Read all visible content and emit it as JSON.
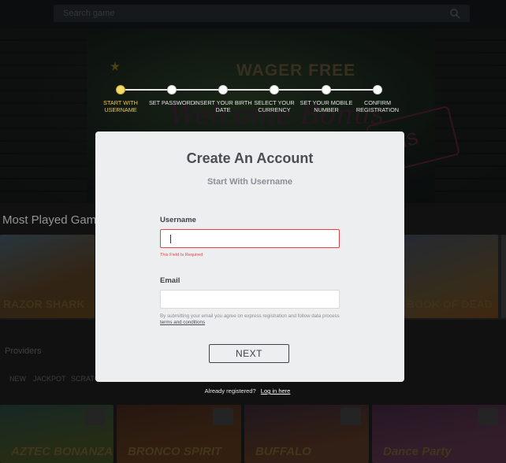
{
  "header": {
    "search_placeholder": "Search game"
  },
  "hero": {
    "neon_title": "WAGER FREE",
    "neon_script": "Welcome Bonus",
    "neon_sign": "NS"
  },
  "background": {
    "section_title": "Most Played Games",
    "tile_labels": [
      "RAZOR SHARK",
      "BOOK OF DEAD"
    ],
    "providers_label": "Providers",
    "tabs": [
      "NEW",
      "JACKPOT",
      "SCRATCH"
    ],
    "games": [
      "AZTEC BONANZA",
      "BRONCO SPIRIT",
      "BUFFALO",
      "Dance Party"
    ]
  },
  "stepper": {
    "steps": [
      {
        "label": "START WITH USERNAME",
        "active": true
      },
      {
        "label": "SET PASSWORD",
        "active": false
      },
      {
        "label": "INSERT YOUR BIRTH DATE",
        "active": false
      },
      {
        "label": "SELECT YOUR CURRENCY",
        "active": false
      },
      {
        "label": "SET YOUR MOBILE NUMBER",
        "active": false
      },
      {
        "label": "CONFIRM REGISTRATION",
        "active": false
      }
    ]
  },
  "modal": {
    "title": "Create An Account",
    "subtitle": "Start With Username",
    "username": {
      "label": "Username",
      "value": "",
      "error": "This Field Is Required"
    },
    "email": {
      "label": "Email",
      "value": ""
    },
    "disclaimer_text": "By submitting your email you agree on express registration and follow data process",
    "disclaimer_link": "terms and conditions",
    "next_label": "NEXT"
  },
  "footer": {
    "already_text": "Already registered?",
    "login_link": "Log in here"
  },
  "colors": {
    "active_step": "#f4dc6a",
    "error": "#e04545",
    "modal_bg": "#eceef0"
  }
}
